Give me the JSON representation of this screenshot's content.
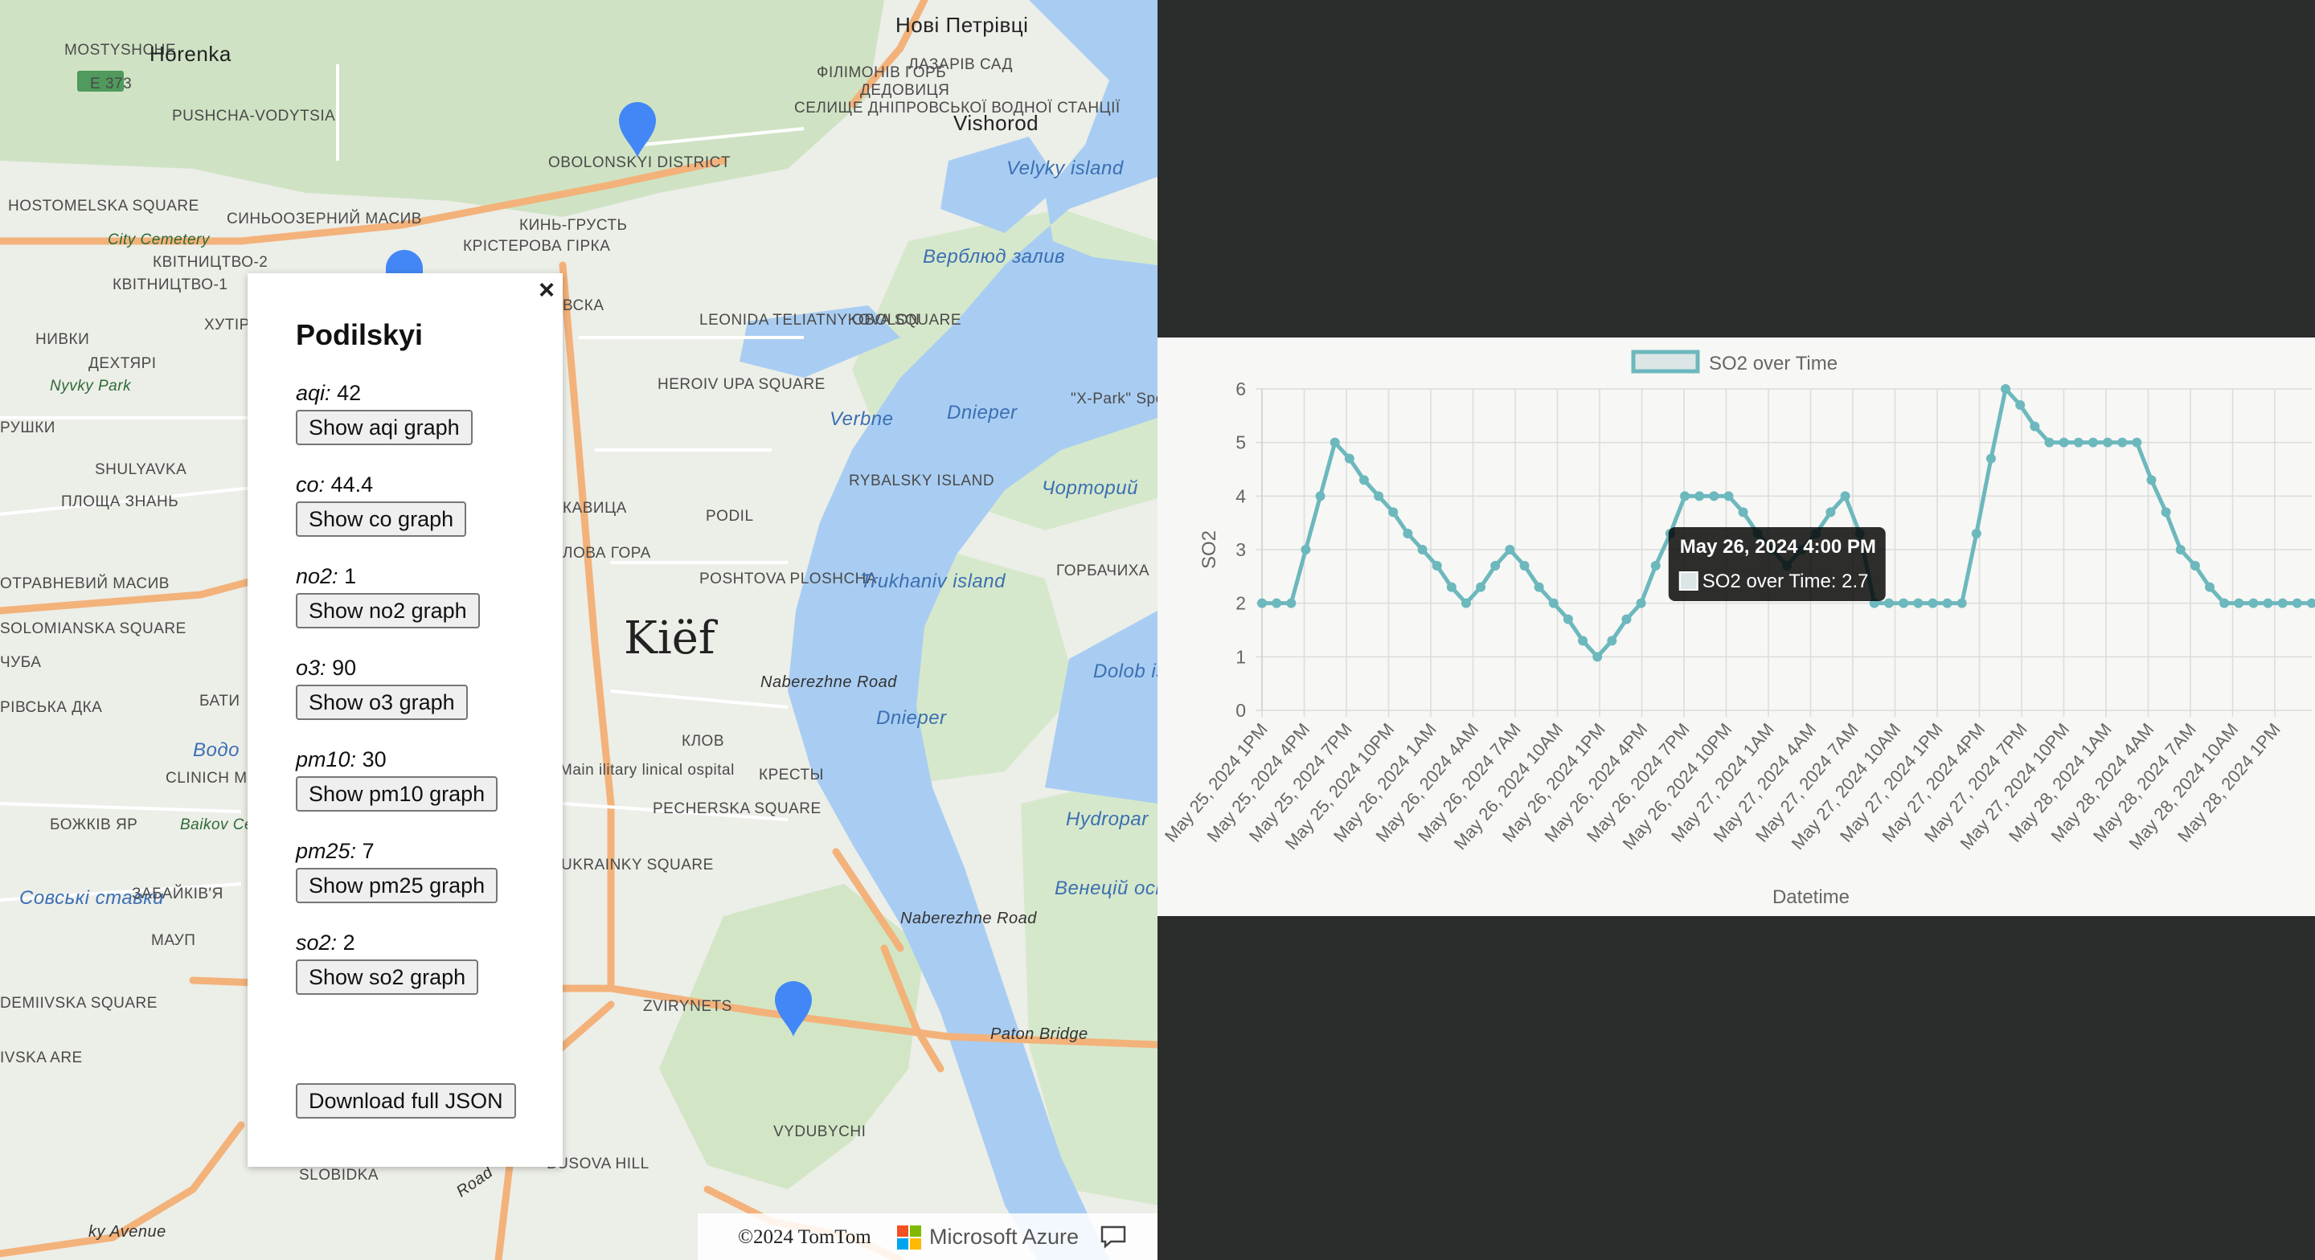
{
  "map": {
    "labels": [
      {
        "text": "MOSTYSHCHE",
        "cls": ""
      },
      {
        "text": "Horenka",
        "cls": "city"
      },
      {
        "text": "E 373",
        "cls": ""
      },
      {
        "text": "PUSHCHA-VODYTSIA",
        "cls": ""
      },
      {
        "text": "Нові Петрівці",
        "cls": "city"
      },
      {
        "text": "ФІЛІМОНІВ ГОРБ",
        "cls": ""
      },
      {
        "text": "ЛАЗАРІВ САД",
        "cls": ""
      },
      {
        "text": "ДЕДОВИЦЯ",
        "cls": ""
      },
      {
        "text": "СЕЛИЩЕ ДНІПРОВСЬКОЇ ВОДНОЇ СТАНЦІЇ",
        "cls": ""
      },
      {
        "text": "Vishorod",
        "cls": "city"
      },
      {
        "text": "OBOLONSKYI DISTRICT",
        "cls": ""
      },
      {
        "text": "Velyky island",
        "cls": "water"
      },
      {
        "text": "HOSTOMELSKA SQUARE",
        "cls": ""
      },
      {
        "text": "СИНЬООЗЕРНИЙ МАСИВ",
        "cls": ""
      },
      {
        "text": "КИНЬ-ГРУСТЬ",
        "cls": ""
      },
      {
        "text": "City Cemetery",
        "cls": "park"
      },
      {
        "text": "КВІТНИЦТВО-2",
        "cls": ""
      },
      {
        "text": "КРІСТЕРОВА ГІРКА",
        "cls": ""
      },
      {
        "text": "Верблюд залив",
        "cls": "water"
      },
      {
        "text": "КВІТНИЦТВО-1",
        "cls": ""
      },
      {
        "text": "ХУТІР",
        "cls": ""
      },
      {
        "text": "ВСКА",
        "cls": ""
      },
      {
        "text": "LEONIDA TELIATNYKOVA SQUARE",
        "cls": ""
      },
      {
        "text": "OBOLON",
        "cls": ""
      },
      {
        "text": "НИВКИ",
        "cls": ""
      },
      {
        "text": "ДЕХТЯРІ",
        "cls": ""
      },
      {
        "text": "Nyvky Park",
        "cls": "park"
      },
      {
        "text": "HEROIV UPA SQUARE",
        "cls": ""
      },
      {
        "text": "Dnieper",
        "cls": "water"
      },
      {
        "text": "\"X-Park\" Sports and Entertainment Complex",
        "cls": ""
      },
      {
        "text": "РУШКИ",
        "cls": ""
      },
      {
        "text": "Verbne",
        "cls": "water"
      },
      {
        "text": "SHULYAVKA",
        "cls": ""
      },
      {
        "text": "RYBALSKY ISLAND",
        "cls": ""
      },
      {
        "text": "Чорторий",
        "cls": "water"
      },
      {
        "text": "ПЛОЩА ЗНАНЬ",
        "cls": ""
      },
      {
        "text": "КАВИЦА",
        "cls": ""
      },
      {
        "text": "PODIL",
        "cls": ""
      },
      {
        "text": "ЛОВА ГОРА",
        "cls": ""
      },
      {
        "text": "ГОРБАЧИХА",
        "cls": ""
      },
      {
        "text": "ОТРАВНЕВИЙ МАСИВ",
        "cls": ""
      },
      {
        "text": "POSHTOVA PLOSHCHA",
        "cls": ""
      },
      {
        "text": "Trukhaniv island",
        "cls": "water"
      },
      {
        "text": "SOLOMIANSKA SQUARE",
        "cls": ""
      },
      {
        "text": "Kiёf",
        "cls": "big"
      },
      {
        "text": "Dolob isla",
        "cls": "water"
      },
      {
        "text": "ЧУБА",
        "cls": ""
      },
      {
        "text": "Naberezhne Road",
        "cls": "road"
      },
      {
        "text": "БАТИ",
        "cls": ""
      },
      {
        "text": "РІВСЬКА ДКА",
        "cls": ""
      },
      {
        "text": "Dnieper",
        "cls": "water"
      },
      {
        "text": "Водо",
        "cls": "water"
      },
      {
        "text": "КЛОВ",
        "cls": ""
      },
      {
        "text": "CLINICH MISTECH",
        "cls": ""
      },
      {
        "text": "Main ilitary linical ospital",
        "cls": ""
      },
      {
        "text": "КРЕСТЫ",
        "cls": ""
      },
      {
        "text": "Baikov Cemete",
        "cls": "park"
      },
      {
        "text": "БОЖКІВ ЯР",
        "cls": ""
      },
      {
        "text": "PECHERSKA SQUARE",
        "cls": ""
      },
      {
        "text": "Hydropar",
        "cls": "water"
      },
      {
        "text": "Совські ставки",
        "cls": "water"
      },
      {
        "text": "ЗАБАЙКІВ'Я",
        "cls": ""
      },
      {
        "text": "UKRAINKY SQUARE",
        "cls": ""
      },
      {
        "text": "Венецій остр",
        "cls": "water"
      },
      {
        "text": "МАУП",
        "cls": ""
      },
      {
        "text": "Naberezhne Road",
        "cls": "road"
      },
      {
        "text": "DEMIIVSKA SQUARE",
        "cls": ""
      },
      {
        "text": "ZVIRYNETS",
        "cls": ""
      },
      {
        "text": "Paton Bridge",
        "cls": "road"
      },
      {
        "text": "IVSKA ARE",
        "cls": ""
      },
      {
        "text": "VYDUBYCHI",
        "cls": ""
      },
      {
        "text": "SLOBIDKA",
        "cls": ""
      },
      {
        "text": "BUSOVA HILL",
        "cls": ""
      },
      {
        "text": "Road",
        "cls": "road"
      },
      {
        "text": "ky Avenue",
        "cls": "road"
      }
    ],
    "attribution": {
      "copyright": "©2024 TomTom",
      "provider": "Microsoft Azure"
    }
  },
  "popup": {
    "title": "Podilskyi",
    "close_glyph": "×",
    "metrics": [
      {
        "key": "aqi:",
        "value": "42",
        "button": "Show aqi graph"
      },
      {
        "key": "co:",
        "value": "44.4",
        "button": "Show co graph"
      },
      {
        "key": "no2:",
        "value": "1",
        "button": "Show no2 graph"
      },
      {
        "key": "o3:",
        "value": "90",
        "button": "Show o3 graph"
      },
      {
        "key": "pm10:",
        "value": "30",
        "button": "Show pm10 graph"
      },
      {
        "key": "pm25:",
        "value": "7",
        "button": "Show pm25 graph"
      },
      {
        "key": "so2:",
        "value": "2",
        "button": "Show so2 graph"
      }
    ],
    "download_label": "Download full JSON"
  },
  "colors": {
    "line": "#6cb8bd",
    "pin": "#4287f5",
    "water": "#a9cdf2",
    "park": "#cfe3c4",
    "road": "#f3b27a"
  },
  "chart_data": {
    "type": "line",
    "legend_label": "SO2 over Time",
    "xlabel": "Datetime",
    "ylabel": "SO2",
    "ylim": [
      0,
      6
    ],
    "yticks": [
      0,
      1,
      2,
      3,
      4,
      5,
      6
    ],
    "x_tick_labels": [
      "May 25, 2024 1PM",
      "May 25, 2024 4PM",
      "May 25, 2024 7PM",
      "May 25, 2024 10PM",
      "May 26, 2024 1AM",
      "May 26, 2024 4AM",
      "May 26, 2024 7AM",
      "May 26, 2024 10AM",
      "May 26, 2024 1PM",
      "May 26, 2024 4PM",
      "May 26, 2024 7PM",
      "May 26, 2024 10PM",
      "May 27, 2024 1AM",
      "May 27, 2024 4AM",
      "May 27, 2024 7AM",
      "May 27, 2024 10AM",
      "May 27, 2024 1PM",
      "May 27, 2024 4PM",
      "May 27, 2024 7PM",
      "May 27, 2024 10PM",
      "May 28, 2024 1AM",
      "May 28, 2024 4AM",
      "May 28, 2024 7AM",
      "May 28, 2024 10AM",
      "May 28, 2024 1PM"
    ],
    "values": [
      2,
      2,
      2,
      3,
      4,
      5,
      4.7,
      4.3,
      4,
      3.7,
      3.3,
      3,
      2.7,
      2.3,
      2,
      2.3,
      2.7,
      3,
      2.7,
      2.3,
      2,
      1.7,
      1.3,
      1,
      1.3,
      1.7,
      2,
      2.7,
      3.3,
      4,
      4,
      4,
      4,
      3.7,
      3.3,
      3,
      2.7,
      3,
      3.3,
      3.7,
      4,
      3.3,
      2,
      2,
      2,
      2,
      2,
      2,
      2,
      3.3,
      4.7,
      6,
      5.7,
      5.3,
      5,
      5,
      5,
      5,
      5,
      5,
      5,
      4.3,
      3.7,
      3,
      2.7,
      2.3,
      2,
      2,
      2,
      2,
      2,
      2,
      2
    ],
    "tooltip": {
      "title": "May 26, 2024 4:00 PM",
      "label": "SO2 over Time: 2.7",
      "point_index": 27
    }
  }
}
